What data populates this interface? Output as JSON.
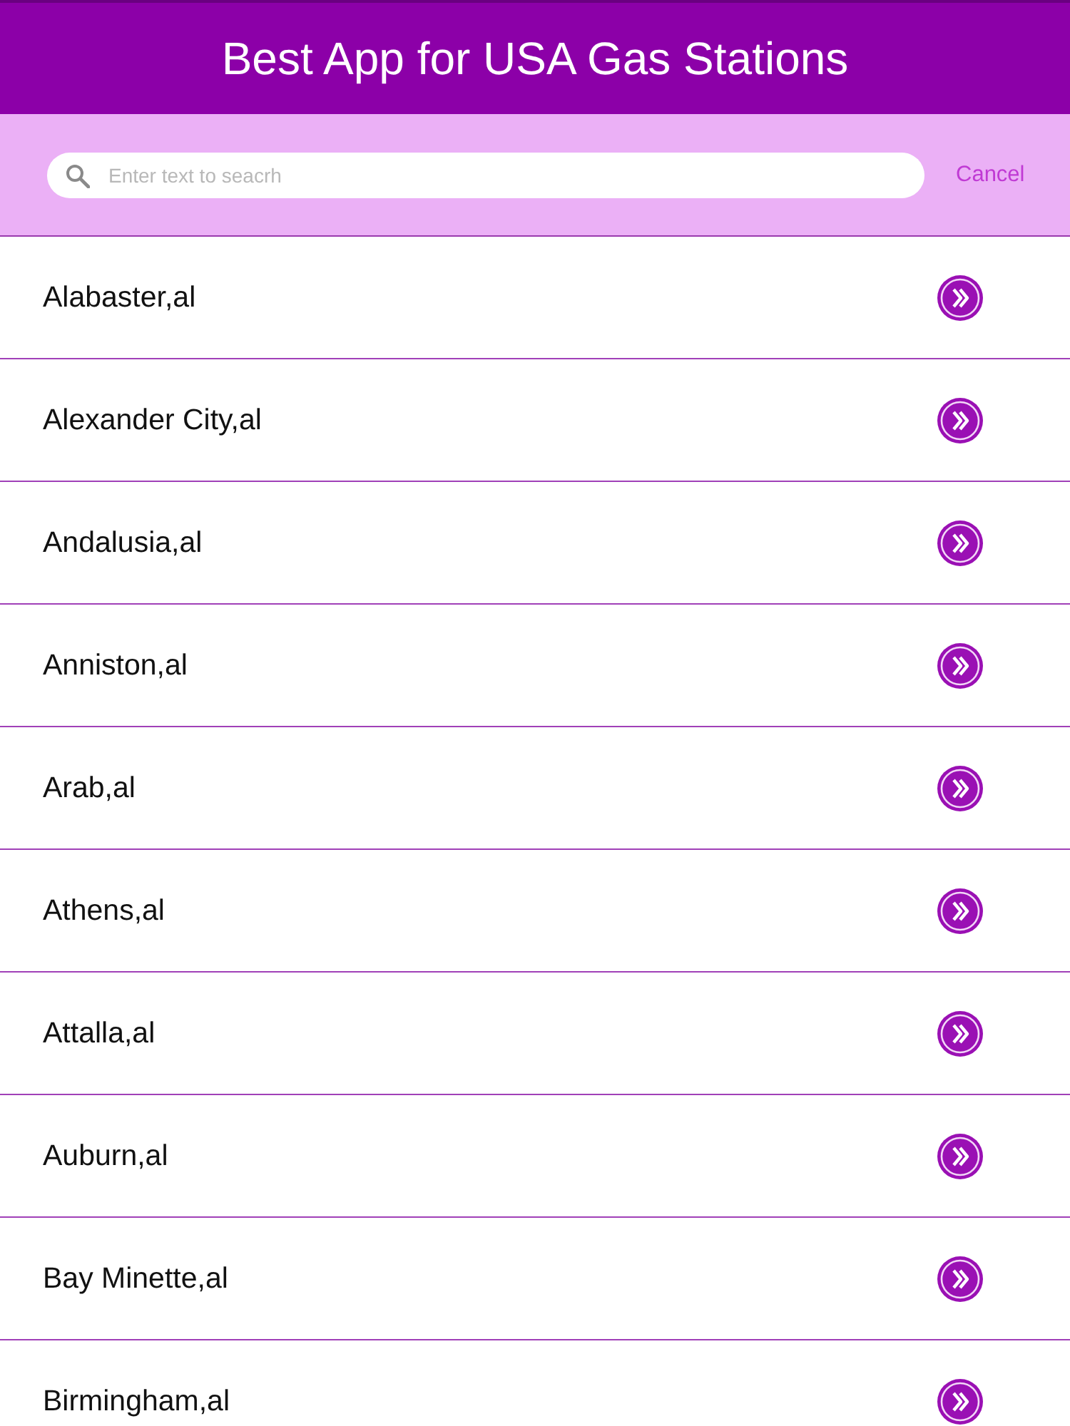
{
  "header": {
    "title": "Best App for USA Gas Stations"
  },
  "search": {
    "placeholder": "Enter text to seacrh",
    "cancel": "Cancel"
  },
  "cities": [
    {
      "name": "Alabaster,al"
    },
    {
      "name": "Alexander City,al"
    },
    {
      "name": "Andalusia,al"
    },
    {
      "name": "Anniston,al"
    },
    {
      "name": "Arab,al"
    },
    {
      "name": "Athens,al"
    },
    {
      "name": "Attalla,al"
    },
    {
      "name": "Auburn,al"
    },
    {
      "name": "Bay Minette,al"
    },
    {
      "name": "Birmingham,al"
    }
  ]
}
